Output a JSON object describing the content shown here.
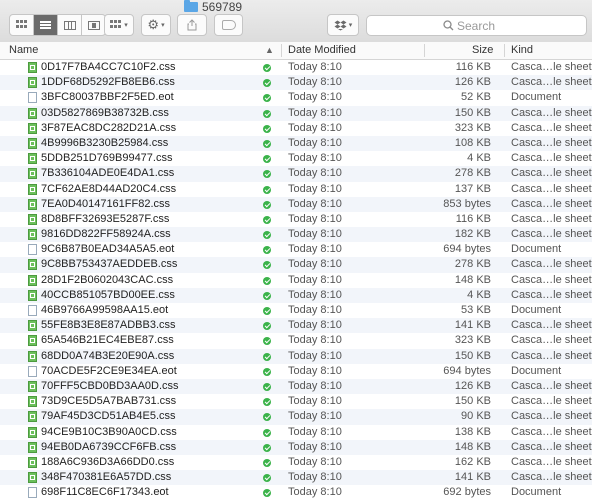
{
  "window": {
    "title": "569789"
  },
  "toolbar": {
    "view_buttons": [
      "icon-view",
      "list-view",
      "column-view",
      "cover-flow-view"
    ],
    "arrange_icon": "grid-icon",
    "action_icon": "gear-icon",
    "share_icon": "share-icon",
    "dropbox_icon": "dropbox-icon"
  },
  "search": {
    "placeholder": "Search"
  },
  "columns": {
    "name": "Name",
    "date": "Date Modified",
    "size": "Size",
    "kind": "Kind"
  },
  "files": [
    {
      "name": "0D17F7BA4CC7C10F2.css",
      "date": "Today 8:10",
      "size": "116 KB",
      "kind": "Casca…le sheet",
      "type": "css"
    },
    {
      "name": "1DDF68D5292FB8EB6.css",
      "date": "Today 8:10",
      "size": "126 KB",
      "kind": "Casca…le sheet",
      "type": "css"
    },
    {
      "name": "3BFC80037BBF2F5ED.eot",
      "date": "Today 8:10",
      "size": "52 KB",
      "kind": "Document",
      "type": "eot"
    },
    {
      "name": "03D5827869B38732B.css",
      "date": "Today 8:10",
      "size": "150 KB",
      "kind": "Casca…le sheet",
      "type": "css"
    },
    {
      "name": "3F87EAC8DC282D21A.css",
      "date": "Today 8:10",
      "size": "323 KB",
      "kind": "Casca…le sheet",
      "type": "css"
    },
    {
      "name": "4B9996B3230B25984.css",
      "date": "Today 8:10",
      "size": "108 KB",
      "kind": "Casca…le sheet",
      "type": "css"
    },
    {
      "name": "5DDB251D769B99477.css",
      "date": "Today 8:10",
      "size": "4 KB",
      "kind": "Casca…le sheet",
      "type": "css"
    },
    {
      "name": "7B336104ADE0E4DA1.css",
      "date": "Today 8:10",
      "size": "278 KB",
      "kind": "Casca…le sheet",
      "type": "css"
    },
    {
      "name": "7CF62AE8D44AD20C4.css",
      "date": "Today 8:10",
      "size": "137 KB",
      "kind": "Casca…le sheet",
      "type": "css"
    },
    {
      "name": "7EA0D40147161FF82.css",
      "date": "Today 8:10",
      "size": "853 bytes",
      "kind": "Casca…le sheet",
      "type": "css"
    },
    {
      "name": "8D8BFF32693E5287F.css",
      "date": "Today 8:10",
      "size": "116 KB",
      "kind": "Casca…le sheet",
      "type": "css"
    },
    {
      "name": "9816DD822FF58924A.css",
      "date": "Today 8:10",
      "size": "182 KB",
      "kind": "Casca…le sheet",
      "type": "css"
    },
    {
      "name": "9C6B87B0EAD34A5A5.eot",
      "date": "Today 8:10",
      "size": "694 bytes",
      "kind": "Document",
      "type": "eot"
    },
    {
      "name": "9C8BB753437AEDDEB.css",
      "date": "Today 8:10",
      "size": "278 KB",
      "kind": "Casca…le sheet",
      "type": "css"
    },
    {
      "name": "28D1F2B0602043CAC.css",
      "date": "Today 8:10",
      "size": "148 KB",
      "kind": "Casca…le sheet",
      "type": "css"
    },
    {
      "name": "40CCB851057BD00EE.css",
      "date": "Today 8:10",
      "size": "4 KB",
      "kind": "Casca…le sheet",
      "type": "css"
    },
    {
      "name": "46B9766A99598AA15.eot",
      "date": "Today 8:10",
      "size": "53 KB",
      "kind": "Document",
      "type": "eot"
    },
    {
      "name": "55FE8B3E8E87ADBB3.css",
      "date": "Today 8:10",
      "size": "141 KB",
      "kind": "Casca…le sheet",
      "type": "css"
    },
    {
      "name": "65A546B21EC4EBE87.css",
      "date": "Today 8:10",
      "size": "323 KB",
      "kind": "Casca…le sheet",
      "type": "css"
    },
    {
      "name": "68DD0A74B3E20E90A.css",
      "date": "Today 8:10",
      "size": "150 KB",
      "kind": "Casca…le sheet",
      "type": "css"
    },
    {
      "name": "70ACDE5F2CE9E34EA.eot",
      "date": "Today 8:10",
      "size": "694 bytes",
      "kind": "Document",
      "type": "eot"
    },
    {
      "name": "70FFF5CBD0BD3AA0D.css",
      "date": "Today 8:10",
      "size": "126 KB",
      "kind": "Casca…le sheet",
      "type": "css"
    },
    {
      "name": "73D9CE5D5A7BAB731.css",
      "date": "Today 8:10",
      "size": "150 KB",
      "kind": "Casca…le sheet",
      "type": "css"
    },
    {
      "name": "79AF45D3CD51AB4E5.css",
      "date": "Today 8:10",
      "size": "90 KB",
      "kind": "Casca…le sheet",
      "type": "css"
    },
    {
      "name": "94CE9B10C3B90A0CD.css",
      "date": "Today 8:10",
      "size": "138 KB",
      "kind": "Casca…le sheet",
      "type": "css"
    },
    {
      "name": "94EB0DA6739CCF6FB.css",
      "date": "Today 8:10",
      "size": "148 KB",
      "kind": "Casca…le sheet",
      "type": "css"
    },
    {
      "name": "188A6C936D3A66DD0.css",
      "date": "Today 8:10",
      "size": "162 KB",
      "kind": "Casca…le sheet",
      "type": "css"
    },
    {
      "name": "348F470381E6A57DD.css",
      "date": "Today 8:10",
      "size": "141 KB",
      "kind": "Casca…le sheet",
      "type": "css"
    },
    {
      "name": "698F11C8EC6F17343.eot",
      "date": "Today 8:10",
      "size": "692 bytes",
      "kind": "Document",
      "type": "eot"
    }
  ]
}
